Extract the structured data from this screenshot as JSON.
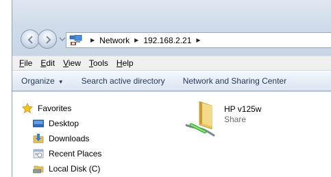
{
  "address": {
    "crumbs": [
      "Network",
      "192.168.2.21"
    ],
    "location_icon": "network-icon"
  },
  "menu": {
    "items": [
      {
        "key": "F",
        "rest": "ile"
      },
      {
        "key": "E",
        "rest": "dit"
      },
      {
        "key": "V",
        "rest": "iew"
      },
      {
        "key": "T",
        "rest": "ools"
      },
      {
        "key": "H",
        "rest": "elp"
      }
    ]
  },
  "commands": {
    "organize": "Organize",
    "search": "Search active directory",
    "network_center": "Network and Sharing Center"
  },
  "navigation": {
    "favorites": "Favorites",
    "items": [
      {
        "label": "Desktop",
        "icon": "desktop-icon"
      },
      {
        "label": "Downloads",
        "icon": "downloads-icon"
      },
      {
        "label": "Recent Places",
        "icon": "recent-places-icon"
      },
      {
        "label": "Local Disk (C)",
        "icon": "local-disk-icon"
      }
    ]
  },
  "files": [
    {
      "name": "HP v125w",
      "type": "Share",
      "icon": "shared-folder-icon"
    }
  ],
  "colors": {
    "command_text": "#1e395b",
    "frame": "#cfdbe9",
    "secondary_text": "#6d6d6d"
  }
}
